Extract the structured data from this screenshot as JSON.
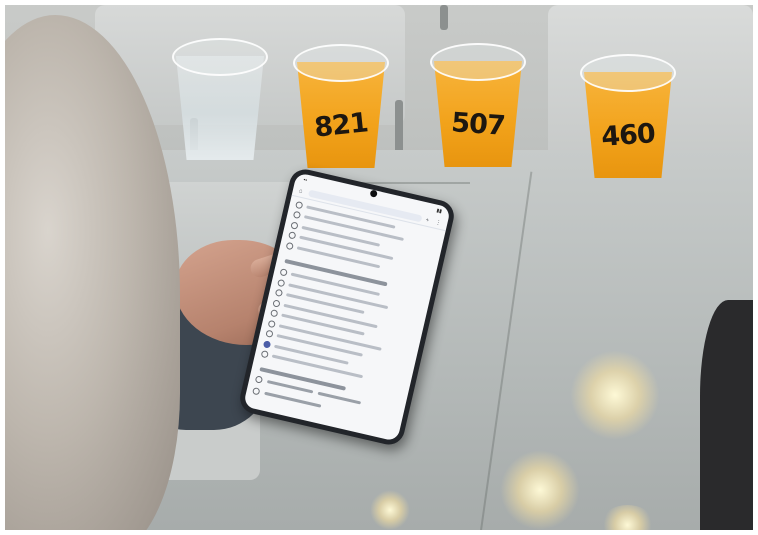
{
  "scene": {
    "description_free": true,
    "cups": [
      {
        "label": "",
        "contents": "water"
      },
      {
        "label": "821",
        "contents": "orange-juice"
      },
      {
        "label": "507",
        "contents": "orange-juice"
      },
      {
        "label": "460",
        "contents": "orange-juice"
      }
    ],
    "colors": {
      "juice": "#f2a21a",
      "water": "#d7e0e3",
      "phone_body": "#22252a",
      "screen": "#f6f7f9",
      "selected_radio": "#4c5ea8"
    },
    "phone_form": {
      "group1_option_count": 5,
      "group2_option_count": 9,
      "group2_selected_index": 7,
      "group3_option_count": 2
    }
  }
}
